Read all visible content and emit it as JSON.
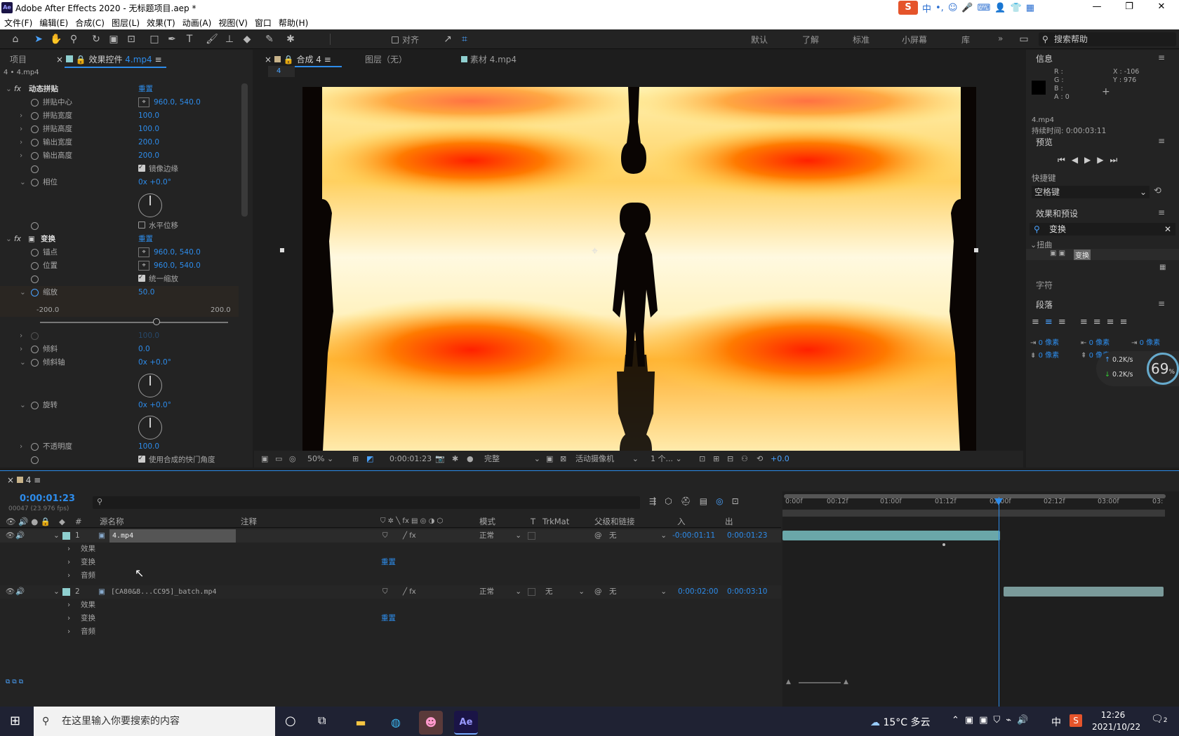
{
  "window": {
    "title": "Adobe After Effects 2020 - 无标题项目.aep *",
    "app_icon": "Ae",
    "ime": {
      "logo": "S",
      "lang": "中",
      "punct": "•,"
    }
  },
  "menu": [
    "文件(F)",
    "编辑(E)",
    "合成(C)",
    "图层(L)",
    "效果(T)",
    "动画(A)",
    "视图(V)",
    "窗口",
    "帮助(H)"
  ],
  "toolbar": {
    "align_label": "对齐",
    "workspaces": [
      "默认",
      "了解",
      "标准",
      "小屏幕",
      "库"
    ],
    "more": "»",
    "search_placeholder": "搜索帮助"
  },
  "left_panel": {
    "tab_project": "项目",
    "tab_effects_prefix": "效果控件",
    "tab_effects_file": "4.mp4",
    "layer_path": "4 • 4.mp4",
    "fx1": {
      "name": "动态拼贴",
      "reset": "重置",
      "props": [
        {
          "label": "拼贴中心",
          "value": "960.0, 540.0",
          "point": true
        },
        {
          "label": "拼贴宽度",
          "value": "100.0"
        },
        {
          "label": "拼贴高度",
          "value": "100.0"
        },
        {
          "label": "输出宽度",
          "value": "200.0"
        },
        {
          "label": "输出高度",
          "value": "200.0"
        },
        {
          "label": "",
          "value": "镜像边缘",
          "check": true
        },
        {
          "label": "相位",
          "value": "0x +0.0°"
        },
        {
          "label": "",
          "value": "水平位移",
          "check": false
        }
      ]
    },
    "fx2": {
      "name": "变换",
      "reset": "重置",
      "props": [
        {
          "label": "锚点",
          "value": "960.0, 540.0",
          "point": true
        },
        {
          "label": "位置",
          "value": "960.0, 540.0",
          "point": true
        },
        {
          "label": "",
          "value": "统一缩放",
          "check": true
        },
        {
          "label": "缩放",
          "value": "50.0"
        }
      ],
      "scale_min": "-200.0",
      "scale_max": "200.0",
      "scale_fraction": 0.62,
      "props2": [
        {
          "label": "",
          "value": "100.0",
          "dim": true
        },
        {
          "label": "倾斜",
          "value": "0.0"
        },
        {
          "label": "倾斜轴",
          "value": "0x +0.0°"
        }
      ],
      "rotate": {
        "label": "旋转",
        "value": "0x +0.0°"
      },
      "opacity": {
        "label": "不透明度",
        "value": "100.0"
      },
      "shutter": {
        "label": "使用合成的快门角度"
      }
    }
  },
  "comp_panel": {
    "tabs": [
      "合成 4",
      "图层（无）",
      "素材 4.mp4"
    ],
    "sub_tab": "4",
    "footer": {
      "zoom": "50%",
      "time": "0:00:01:23",
      "quality": "完整",
      "camera": "活动摄像机",
      "views": "1 个...",
      "exposure": "+0.0"
    }
  },
  "info_panel": {
    "title": "信息",
    "r": "R :",
    "g": "G :",
    "b": "B :",
    "a": "A : 0",
    "x": "X : -106",
    "y": "Y : 976",
    "file": "4.mp4",
    "duration": "持续时间: 0:00:03:11"
  },
  "preview_panel": {
    "title": "预览",
    "shortcut_label": "快捷键",
    "shortcut_value": "空格键"
  },
  "effects_presets": {
    "title": "效果和预设",
    "search": "变换",
    "category": "扭曲",
    "item": "变换"
  },
  "char_panel": {
    "title": "字符"
  },
  "para_panel": {
    "title": "段落",
    "indent": [
      "0 像素",
      "0 像素",
      "0 像素",
      "0 像素",
      "0 像素"
    ]
  },
  "net": {
    "up": "0.2K/s",
    "down": "0.2K/s",
    "percent": "69"
  },
  "timeline": {
    "comp_name": "4",
    "timecode": "0:00:01:23",
    "fps_info": "00047 (23.976 fps)",
    "headers": {
      "source": "源名称",
      "comment": "注释",
      "mode": "模式",
      "t": "T",
      "trkmat": "TrkMat",
      "parent": "父级和链接",
      "in": "入",
      "out": "出"
    },
    "ruler": [
      "0:00f",
      "00:12f",
      "01:00f",
      "01:12f",
      "02:00f",
      "02:12f",
      "03:00f",
      "03:"
    ],
    "layers": [
      {
        "num": "1",
        "name": "4.mp4",
        "mode": "正常",
        "trkmat": "",
        "parent": "无",
        "in": "-0:00:01:11",
        "out": "0:00:01:23",
        "sub": [
          "效果",
          "变换",
          "音频"
        ],
        "reset": "重置"
      },
      {
        "num": "2",
        "name": "[CA80&8...CC95]_batch.mp4",
        "mode": "正常",
        "trkmat": "无",
        "parent": "无",
        "in": "0:00:02:00",
        "out": "0:00:03:10",
        "sub": [
          "效果",
          "变换",
          "音频"
        ],
        "reset": "重置"
      }
    ]
  },
  "taskbar": {
    "search_placeholder": "在这里输入你要搜索的内容",
    "weather": "15°C 多云",
    "ime": "中",
    "time": "12:26",
    "date": "2021/10/22",
    "notif": "2"
  }
}
